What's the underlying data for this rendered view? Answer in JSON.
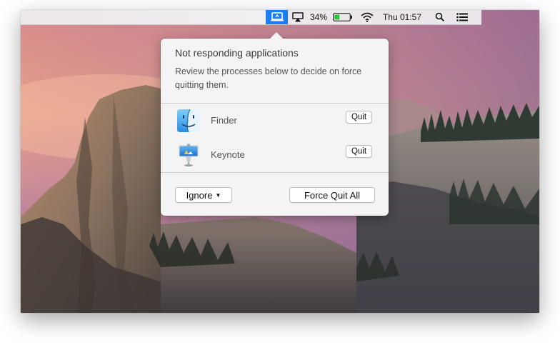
{
  "menubar": {
    "battery_percent": "34%",
    "battery_level": 0.34,
    "clock": "Thu 01:57",
    "items": [
      "app-monitor-icon",
      "airplay-icon",
      "battery-icon",
      "wifi-icon",
      "spotlight-search-icon",
      "notification-center-icon"
    ]
  },
  "popover": {
    "title": "Not responding applications",
    "description": "Review the processes below to decide on force quitting them.",
    "apps": [
      {
        "name": "Finder",
        "quit_label": "Quit",
        "icon": "finder-icon"
      },
      {
        "name": "Keynote",
        "quit_label": "Quit",
        "icon": "keynote-icon"
      }
    ],
    "ignore_label": "Ignore",
    "force_quit_all_label": "Force Quit All"
  },
  "colors": {
    "accent": "#1d7cf2",
    "popover_bg": "#f4f4f4",
    "battery_green": "#2bc33a"
  }
}
